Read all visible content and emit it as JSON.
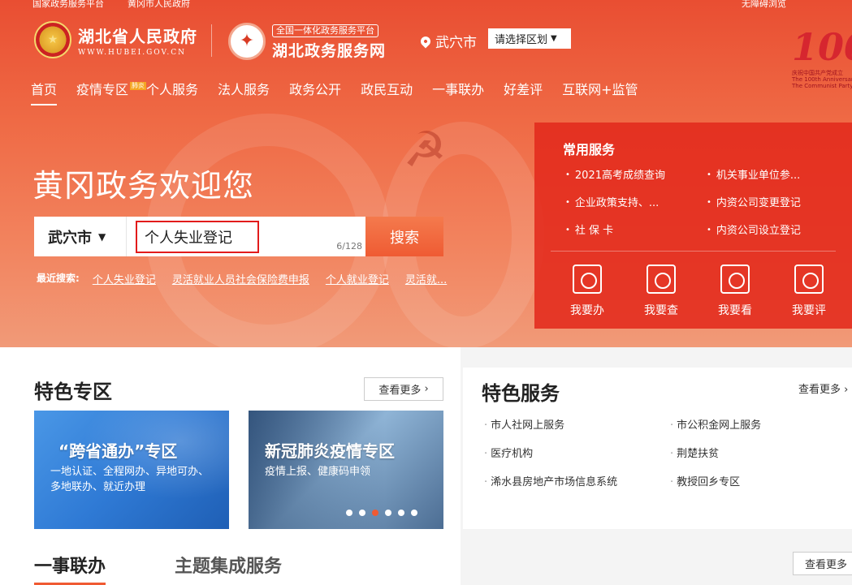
{
  "top_links": [
    "国家政务服务平台",
    "黄冈市人民政府",
    "无障碍浏览"
  ],
  "header": {
    "gov_name": "湖北省人民政府",
    "gov_url": "WWW.HUBEI.GOV.CN",
    "platform_badge": "全国一体化政务服务平台",
    "platform_name": "湖北政务服务网",
    "location": "武穴市",
    "region_select": "请选择区划",
    "anniversary": {
      "number": "100",
      "line1": "庆祝中国共产党成立",
      "line2": "The 100th Anniversary of the",
      "line3": "The Communist Party"
    }
  },
  "nav": [
    {
      "label": "首页",
      "active": true
    },
    {
      "label": "疫情专区",
      "tag": "肺炎"
    },
    {
      "label": "个人服务"
    },
    {
      "label": "法人服务"
    },
    {
      "label": "政务公开"
    },
    {
      "label": "政民互动"
    },
    {
      "label": "一事联办"
    },
    {
      "label": "好差评"
    },
    {
      "label": "互联网+监管"
    }
  ],
  "welcome": "黄冈政务欢迎您",
  "search": {
    "city": "武穴市",
    "value": "个人失业登记",
    "counter": "6/128",
    "button": "搜索"
  },
  "recent": {
    "label": "最近搜索:",
    "items": [
      "个人失业登记",
      "灵活就业人员社会保险费申报",
      "个人就业登记",
      "灵活就..."
    ]
  },
  "common_services": {
    "title": "常用服务",
    "items": [
      "2021高考成绩查询",
      "机关事业单位参...",
      "企业政策支持、...",
      "内资公司变更登记",
      "社 保 卡",
      "内资公司设立登记"
    ],
    "actions": [
      "我要办",
      "我要查",
      "我要看",
      "我要评"
    ]
  },
  "featured_zone": {
    "title": "特色专区",
    "more": "查看更多",
    "cards": [
      {
        "title": "“跨省通办”专区",
        "subtitle": "一地认证、全程网办、异地可办、多地联办、就近办理"
      },
      {
        "title": "新冠肺炎疫情专区",
        "subtitle": "疫情上报、健康码申领"
      }
    ],
    "active_dot": 2,
    "dot_count": 6
  },
  "featured_services": {
    "title": "特色服务",
    "more": "查看更多",
    "items": [
      "市人社网上服务",
      "市公积金网上服务",
      "医疗机构",
      "荆楚扶贫",
      "浠水县房地产市场信息系统",
      "教授回乡专区"
    ]
  },
  "bottom_tabs": {
    "tabs": [
      "一事联办",
      "主题集成服务"
    ],
    "more": "查看更多"
  },
  "colors": {
    "brand_red": "#e94e32",
    "accent_orange": "#f05a32",
    "search_highlight": "#e21b1b"
  }
}
